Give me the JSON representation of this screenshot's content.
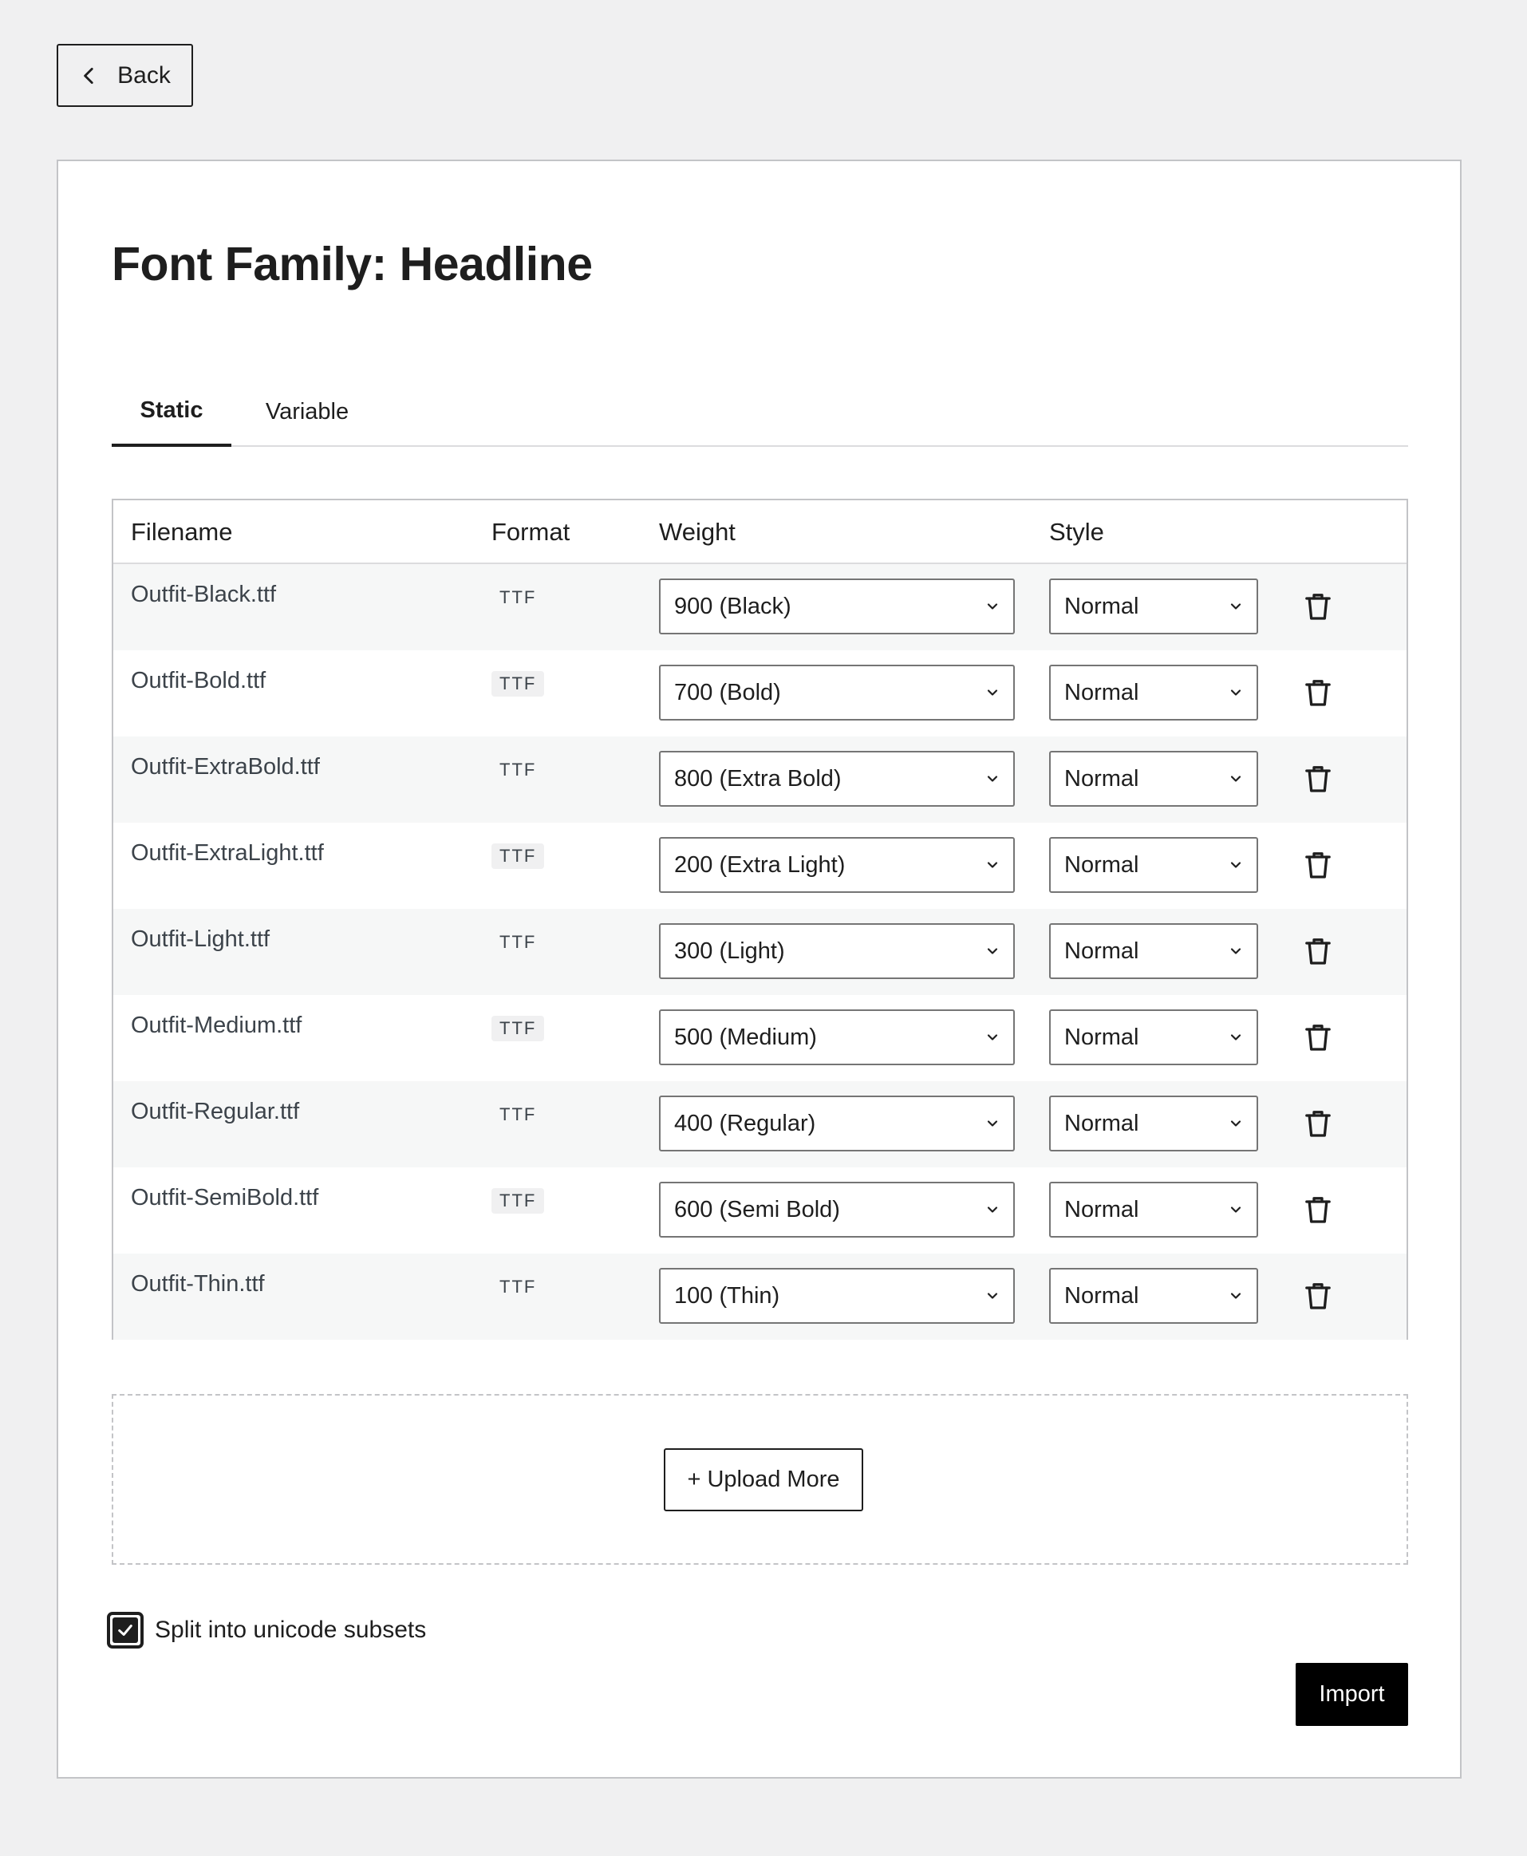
{
  "back_label": "Back",
  "title": "Font Family: Headline",
  "tabs": [
    {
      "label": "Static",
      "active": true
    },
    {
      "label": "Variable",
      "active": false
    }
  ],
  "table": {
    "headers": {
      "filename": "Filename",
      "format": "Format",
      "weight": "Weight",
      "style": "Style"
    },
    "rows": [
      {
        "filename": "Outfit-Black.ttf",
        "format": "TTF",
        "weight": "900 (Black)",
        "style": "Normal"
      },
      {
        "filename": "Outfit-Bold.ttf",
        "format": "TTF",
        "weight": "700 (Bold)",
        "style": "Normal"
      },
      {
        "filename": "Outfit-ExtraBold.ttf",
        "format": "TTF",
        "weight": "800 (Extra Bold)",
        "style": "Normal"
      },
      {
        "filename": "Outfit-ExtraLight.ttf",
        "format": "TTF",
        "weight": "200 (Extra Light)",
        "style": "Normal"
      },
      {
        "filename": "Outfit-Light.ttf",
        "format": "TTF",
        "weight": "300 (Light)",
        "style": "Normal"
      },
      {
        "filename": "Outfit-Medium.ttf",
        "format": "TTF",
        "weight": "500 (Medium)",
        "style": "Normal"
      },
      {
        "filename": "Outfit-Regular.ttf",
        "format": "TTF",
        "weight": "400 (Regular)",
        "style": "Normal"
      },
      {
        "filename": "Outfit-SemiBold.ttf",
        "format": "TTF",
        "weight": "600 (Semi Bold)",
        "style": "Normal"
      },
      {
        "filename": "Outfit-Thin.ttf",
        "format": "TTF",
        "weight": "100 (Thin)",
        "style": "Normal"
      }
    ]
  },
  "upload_label": "+ Upload More",
  "checkbox": {
    "label": "Split into unicode subsets",
    "checked": true
  },
  "import_label": "Import",
  "colors": {
    "accent": "#1e1e1e",
    "import_bg": "#000000",
    "page_bg": "#f0f0f1",
    "row_shade": "#f6f7f7"
  },
  "icons": {
    "back": "chevron-left-icon",
    "select": "chevron-down-icon",
    "delete": "trash-icon",
    "check": "checkmark-icon"
  }
}
